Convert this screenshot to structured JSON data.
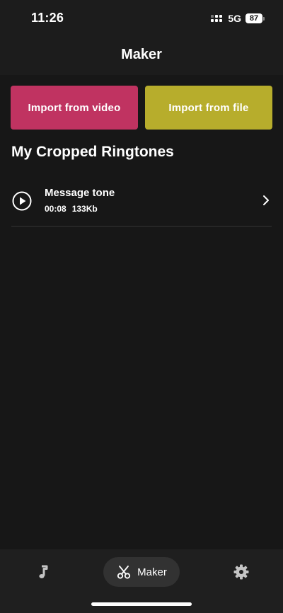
{
  "status_bar": {
    "time": "11:26",
    "network": "5G",
    "battery": "87"
  },
  "header": {
    "title": "Maker"
  },
  "buttons": {
    "import_video": "Import from video",
    "import_file": "Import from file"
  },
  "colors": {
    "import_video": "#c03361",
    "import_file": "#b7ad2c"
  },
  "section": {
    "title": "My Cropped Ringtones"
  },
  "ringtones": [
    {
      "name": "Message tone",
      "duration": "00:08",
      "size": "133Kb"
    }
  ],
  "tab_bar": {
    "tabs": [
      {
        "icon": "music-note-icon"
      },
      {
        "icon": "scissors-icon",
        "label": "Maker",
        "active": true
      },
      {
        "icon": "gear-icon"
      }
    ]
  }
}
